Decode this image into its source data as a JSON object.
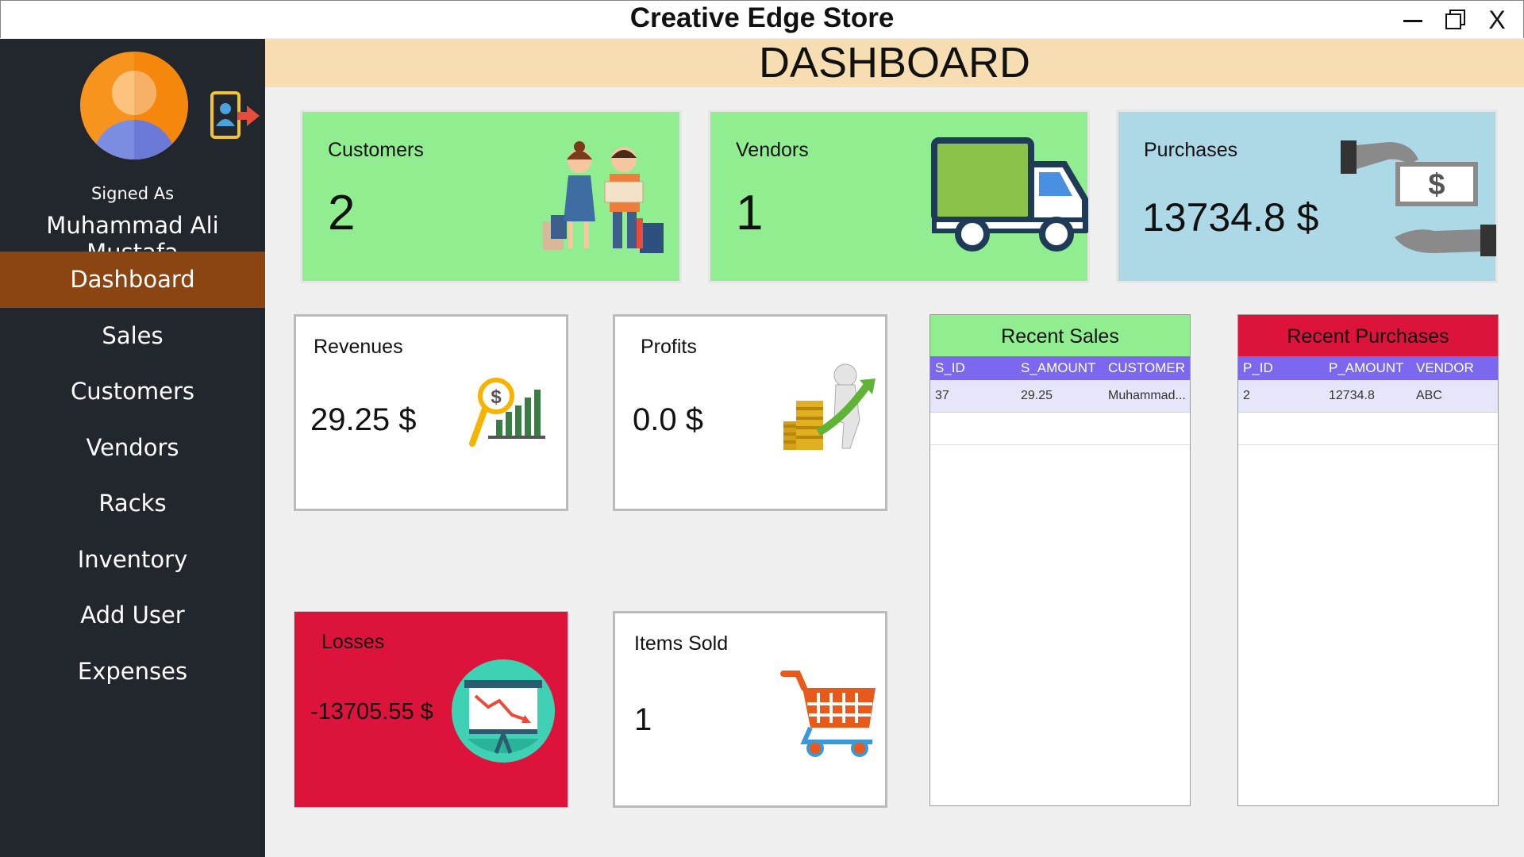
{
  "window": {
    "title": "Creative Edge Store",
    "close_label": "X"
  },
  "sidebar": {
    "signed_as_label": "Signed As",
    "user_name": "Muhammad Ali Mustafa",
    "items": [
      {
        "label": "Dashboard",
        "active": true
      },
      {
        "label": "Sales"
      },
      {
        "label": "Customers"
      },
      {
        "label": "Vendors"
      },
      {
        "label": "Racks"
      },
      {
        "label": "Inventory"
      },
      {
        "label": "Add User"
      },
      {
        "label": "Expenses"
      }
    ]
  },
  "header": {
    "title": "DASHBOARD"
  },
  "cards": {
    "customers": {
      "label": "Customers",
      "value": "2"
    },
    "vendors": {
      "label": "Vendors",
      "value": "1"
    },
    "purchases": {
      "label": "Purchases",
      "value": "13734.8 $"
    },
    "revenues": {
      "label": "Revenues",
      "value": "29.25 $"
    },
    "profits": {
      "label": "Profits",
      "value": "0.0 $"
    },
    "losses": {
      "label": "Losses",
      "value": "-13705.55 $"
    },
    "items_sold": {
      "label": "Items Sold",
      "value": "1"
    }
  },
  "recent_sales": {
    "title": "Recent Sales",
    "columns": [
      "S_ID",
      "S_AMOUNT",
      "CUSTOMER"
    ],
    "rows": [
      [
        "37",
        "29.25",
        "Muhammad..."
      ]
    ]
  },
  "recent_purchases": {
    "title": "Recent Purchases",
    "columns": [
      "P_ID",
      "P_AMOUNT",
      "VENDOR"
    ],
    "rows": [
      [
        "2",
        "12734.8",
        "ABC"
      ]
    ]
  },
  "colors": {
    "sidebar_bg": "#22272e",
    "active_nav": "#8b4513",
    "header_bg": "#f7deb2",
    "green_card": "#90ee90",
    "blue_card": "#add8e6",
    "red_card": "#dc143c",
    "table_header": "#7b68ee",
    "table_row": "#e6e6fa"
  }
}
